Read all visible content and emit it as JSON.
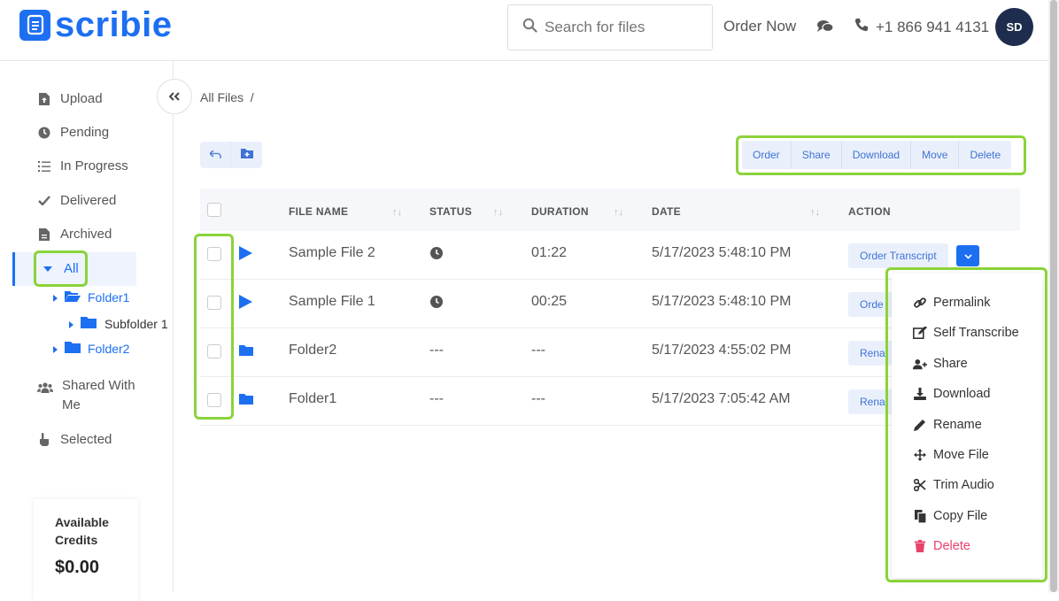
{
  "app": {
    "logo_text": "scribie",
    "brand_color": "#1d6ff2"
  },
  "header": {
    "search_placeholder": "Search for files",
    "order_now": "Order Now",
    "phone": "+1 866 941 4131",
    "avatar_initials": "SD"
  },
  "sidebar": {
    "items": [
      {
        "label": "Upload",
        "icon": "file-upload-icon"
      },
      {
        "label": "Pending",
        "icon": "clock-icon"
      },
      {
        "label": "In Progress",
        "icon": "list-icon"
      },
      {
        "label": "Delivered",
        "icon": "check-icon"
      },
      {
        "label": "Archived",
        "icon": "archive-icon"
      },
      {
        "label": "All",
        "icon": "caret-down-icon"
      },
      {
        "label": "Shared With Me",
        "icon": "users-icon"
      },
      {
        "label": "Selected",
        "icon": "hand-pointer-icon"
      }
    ],
    "tree": {
      "folder1": "Folder1",
      "subfolder1": "Subfolder 1",
      "folder2": "Folder2"
    },
    "credits": {
      "label_line1": "Available",
      "label_line2": "Credits",
      "amount": "$0.00"
    }
  },
  "main": {
    "breadcrumb": "All Files  /",
    "bulk_actions": [
      "Order",
      "Share",
      "Download",
      "Move",
      "Delete"
    ],
    "columns": {
      "file_name": "FILE NAME",
      "status": "STATUS",
      "duration": "DURATION",
      "date": "DATE",
      "action": "ACTION"
    },
    "rows": [
      {
        "name": "Sample File 2",
        "type": "audio",
        "status": "clock",
        "duration": "01:22",
        "date": "5/17/2023 5:48:10 PM",
        "action": "Order Transcript"
      },
      {
        "name": "Sample File 1",
        "type": "audio",
        "status": "clock",
        "duration": "00:25",
        "date": "5/17/2023 5:48:10 PM",
        "action": "Orde"
      },
      {
        "name": "Folder2",
        "type": "folder",
        "status": "---",
        "duration": "---",
        "date": "5/17/2023 4:55:02 PM",
        "action": "Rena"
      },
      {
        "name": "Folder1",
        "type": "folder",
        "status": "---",
        "duration": "---",
        "date": "5/17/2023 7:05:42 AM",
        "action": "Rena"
      }
    ]
  },
  "dropdown_menu": {
    "items": [
      {
        "label": "Permalink",
        "icon": "link-icon"
      },
      {
        "label": "Self Transcribe",
        "icon": "edit-icon"
      },
      {
        "label": "Share",
        "icon": "user-plus-icon"
      },
      {
        "label": "Download",
        "icon": "download-icon"
      },
      {
        "label": "Rename",
        "icon": "pencil-icon"
      },
      {
        "label": "Move File",
        "icon": "arrows-move-icon"
      },
      {
        "label": "Trim Audio",
        "icon": "scissors-icon"
      },
      {
        "label": "Copy File",
        "icon": "copy-icon"
      },
      {
        "label": "Delete",
        "icon": "trash-icon"
      }
    ],
    "delete_color": "#e8416b"
  }
}
